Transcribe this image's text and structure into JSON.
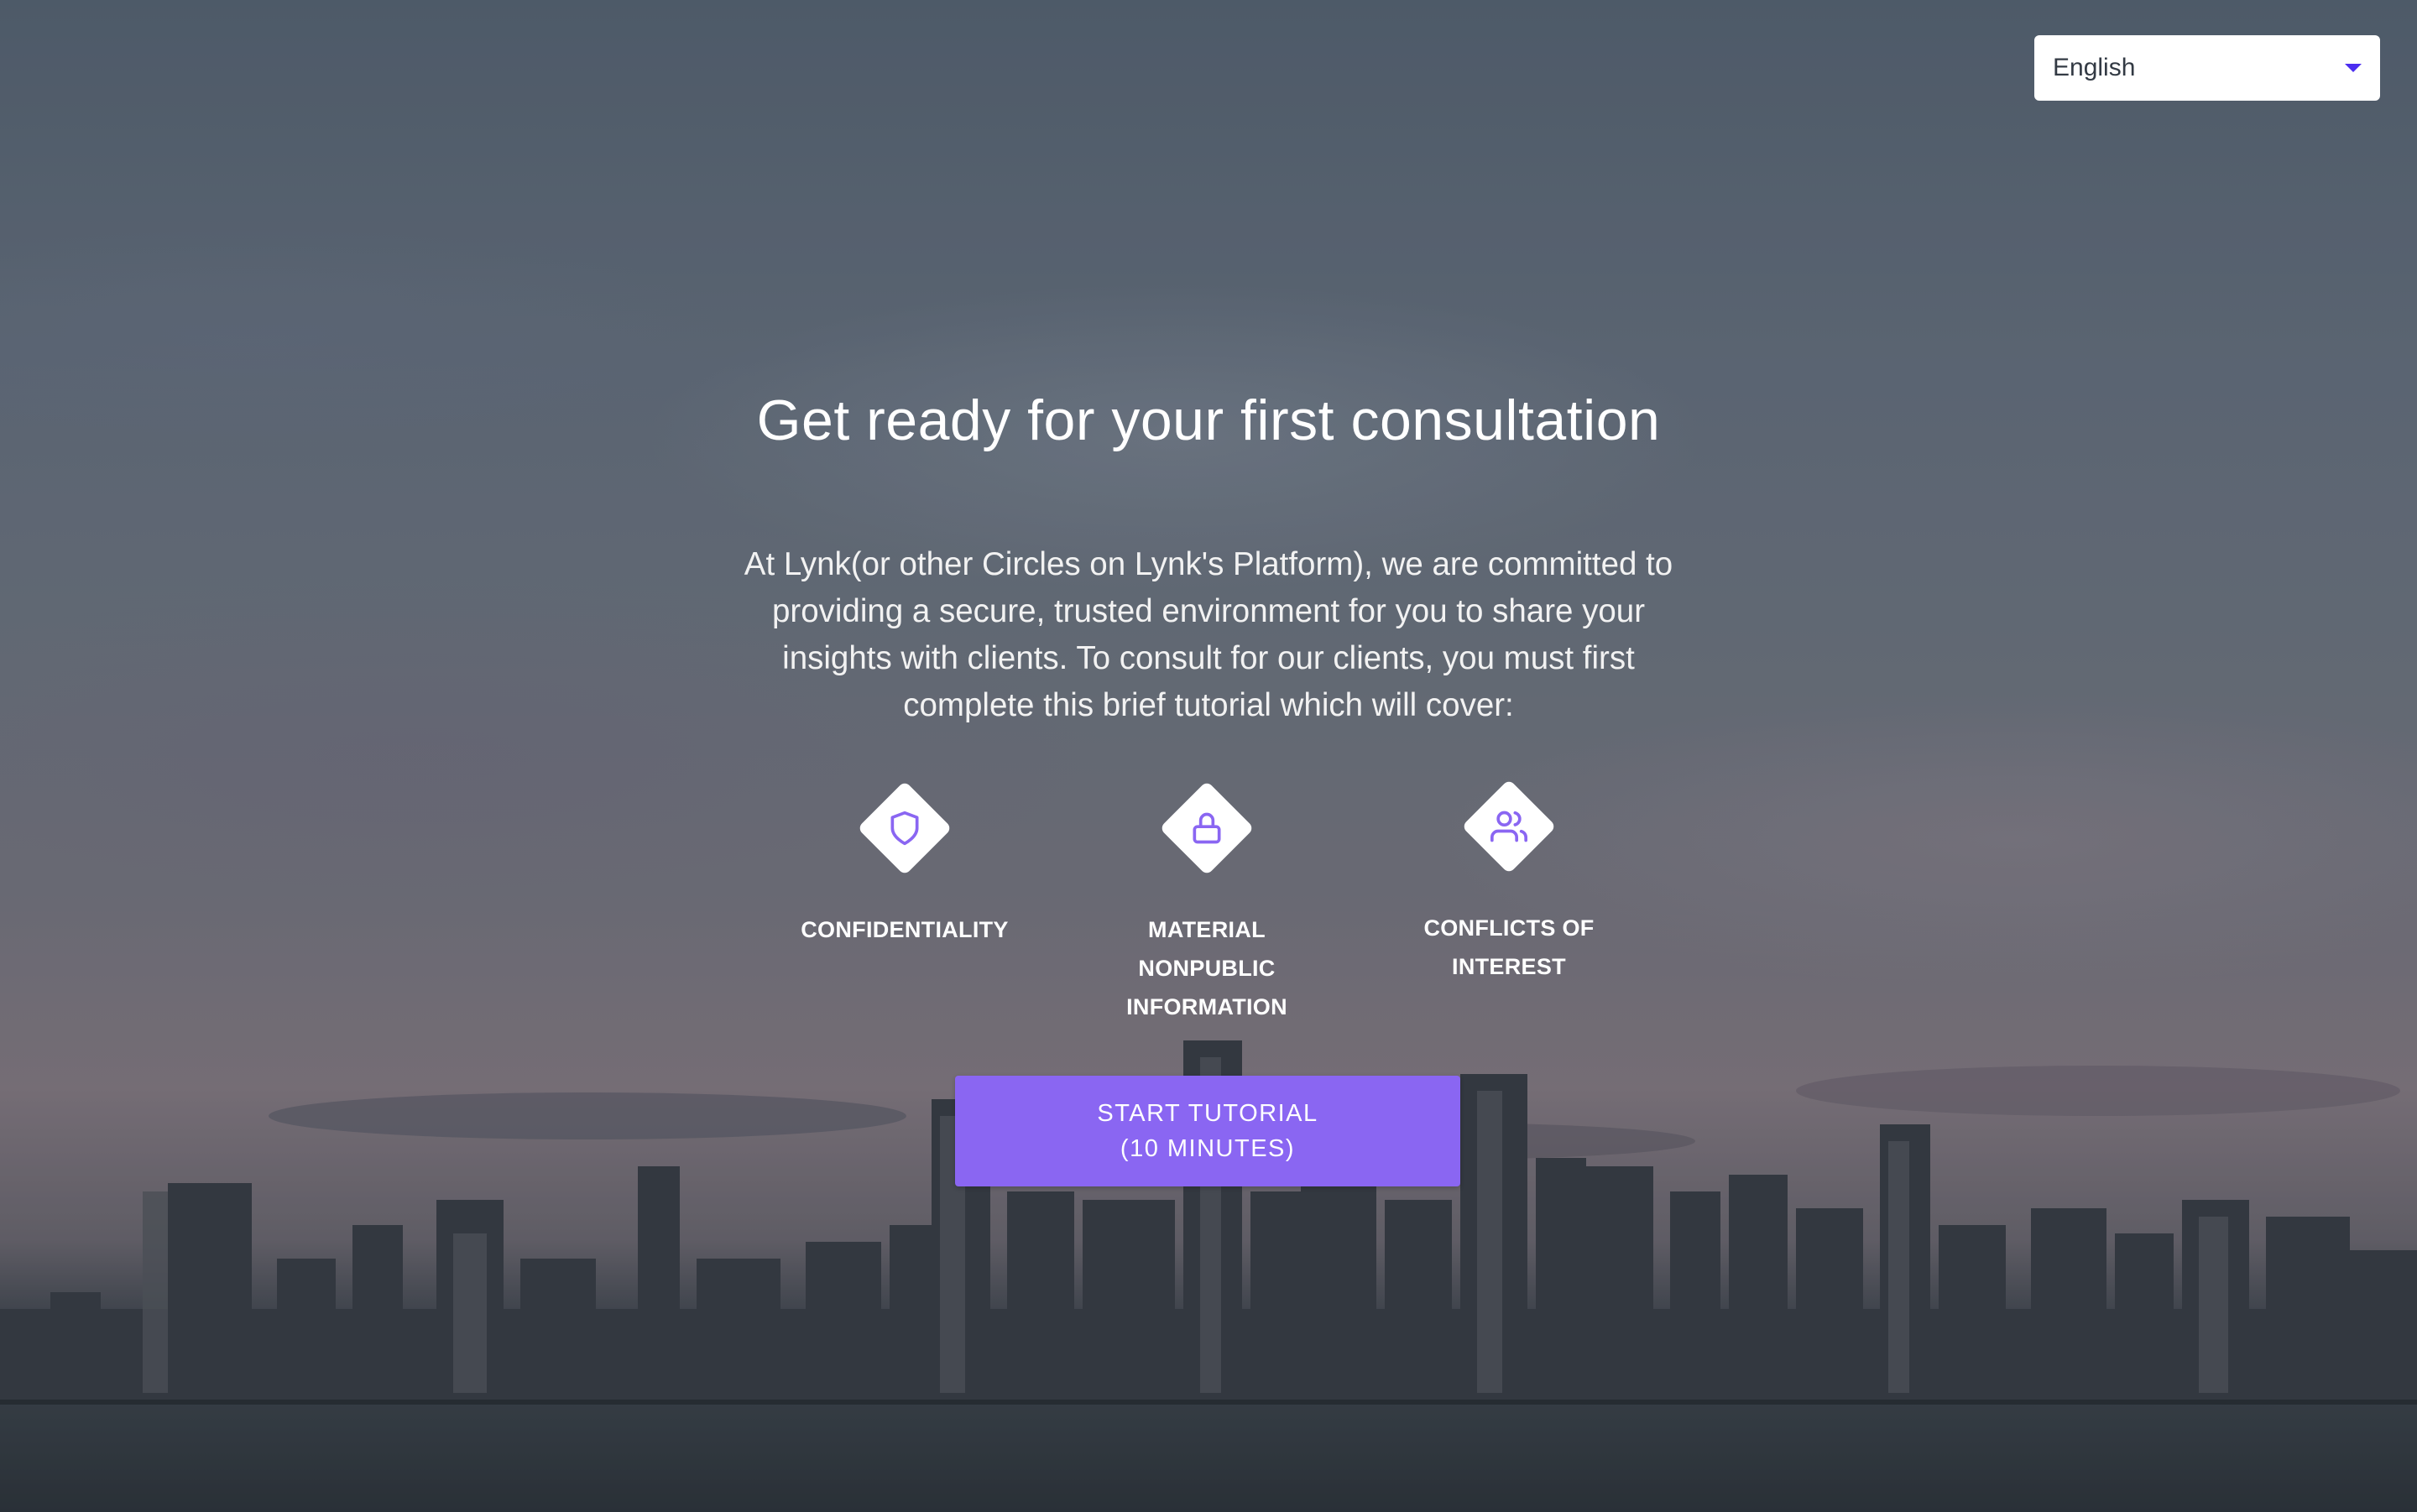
{
  "language_select": {
    "value": "English",
    "icon": "caret-down-icon"
  },
  "title": "Get ready for your first consultation",
  "intro": "At Lynk(or other Circles on Lynk's Platform), we are committed to providing a secure, trusted environment for you to share your insights with clients. To consult for our clients, you must first complete this brief tutorial which will cover:",
  "topics": [
    {
      "icon": "shield-icon",
      "label_lines": [
        "CONFIDENTIALITY"
      ]
    },
    {
      "icon": "lock-icon",
      "label_lines": [
        "MATERIAL",
        "NONPUBLIC",
        "INFORMATION"
      ]
    },
    {
      "icon": "users-icon",
      "label_lines": [
        "CONFLICTS OF",
        "INTEREST"
      ]
    }
  ],
  "start_button": {
    "line1": "START TUTORIAL",
    "line2": "(10 MINUTES)"
  },
  "colors": {
    "accent": "#8a66f2",
    "caret": "#4b2df0",
    "icon_stroke": "#8a66f2"
  }
}
